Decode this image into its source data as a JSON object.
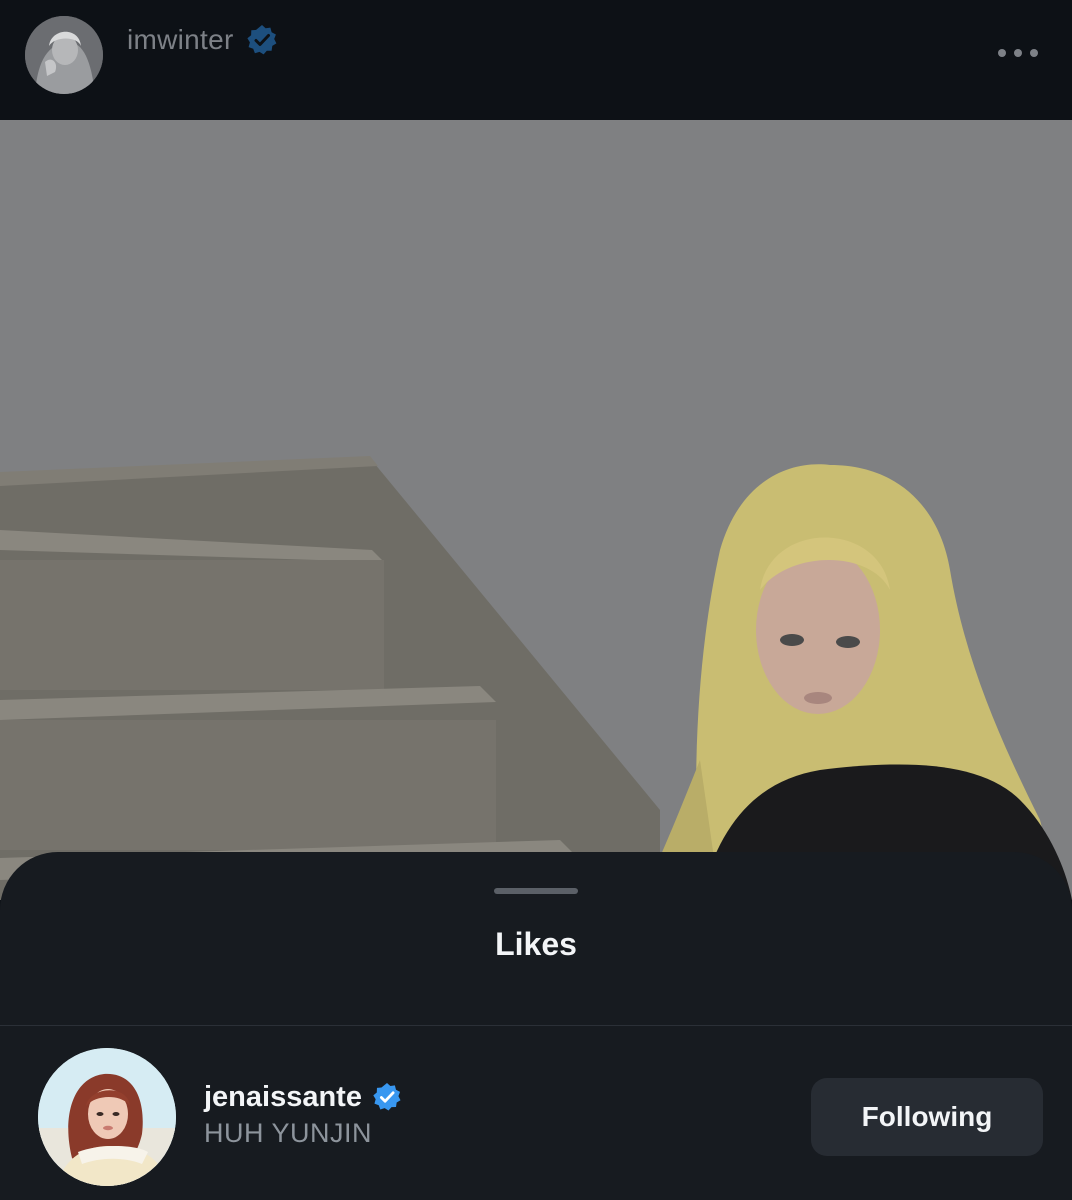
{
  "header": {
    "username": "imwinter",
    "verified": true,
    "avatar": "profile-photo",
    "more_icon": "more-horizontal-icon"
  },
  "post": {
    "image": "photo-blonde-woman-by-stairs",
    "dimmed": true
  },
  "likes_sheet": {
    "title": "Likes",
    "items": [
      {
        "username": "jenaissante",
        "full_name": "HUH YUNJIN",
        "verified": true,
        "avatar": "profile-photo",
        "button_label": "Following"
      }
    ]
  },
  "colors": {
    "background": "#0d1116",
    "sheet": "#171b20",
    "button": "#272c33",
    "verified_blue": "#3897f0",
    "verified_blue_dimmed": "#1d4f7e",
    "dimmed_text": "#7d8187",
    "secondary_text": "#8d949c"
  }
}
